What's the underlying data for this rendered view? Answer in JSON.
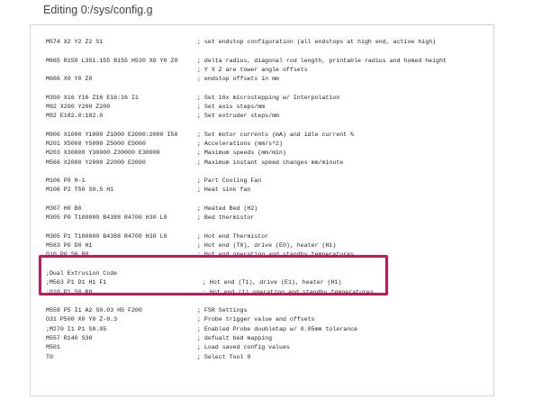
{
  "header": {
    "title": "Editing 0:/sys/config.g"
  },
  "colors": {
    "highlight_border": "#c2185b",
    "editor_border": "#d6d6d6"
  },
  "editor": {
    "lines": [
      {
        "code": "M574 X2 Y2 Z2 S1",
        "comment": "; set endstop configuration (all endstops at high end, active high)"
      },
      {
        "code": "",
        "comment": ""
      },
      {
        "code": "M665 R150 L351.155 B155 H530 X0 Y0 Z0",
        "comment": "; delta radius, diagonal rod length, printable radius and homed height"
      },
      {
        "code": "",
        "comment": "; Y X Z are tower angle offsets"
      },
      {
        "code": "M666 X0 Y0 Z0",
        "comment": "; endstop offsets in mm"
      },
      {
        "code": "",
        "comment": ""
      },
      {
        "code": "M350 X16 Y16 Z16 E16:16 I1",
        "comment": "; Set 16x microstepping w/ Interpolation"
      },
      {
        "code": "M92 X200 Y200 Z200",
        "comment": "; Set axis steps/mm"
      },
      {
        "code": "M92 E182.0:182.0",
        "comment": "; Set extruder steps/mm"
      },
      {
        "code": "",
        "comment": ""
      },
      {
        "code": "M906 X1000 Y1000 Z1000 E2000:2000 I50",
        "comment": "; Set motor currents (mA) and idle current %"
      },
      {
        "code": "M201 X5000 Y5000 Z5000 E5000",
        "comment": "; Accelerations (mm/s^2)"
      },
      {
        "code": "M203 X30000 Y30000 Z30000 E30000",
        "comment": "; Maximum speeds (mm/min)"
      },
      {
        "code": "M566 X2000 Y2000 Z2000 E2000",
        "comment": "; Maximum instant speed changes mm/minute"
      },
      {
        "code": "",
        "comment": ""
      },
      {
        "code": "M106 P0 H-1",
        "comment": "; Part Cooling Fan"
      },
      {
        "code": "M106 P2 T50 S0.5 H1",
        "comment": "; Heat sink fan"
      },
      {
        "code": "",
        "comment": ""
      },
      {
        "code": "M307 H0 B0",
        "comment": "; Heated Bed (H2)"
      },
      {
        "code": "M305 P0 T100000 B4388 R4700 H30 L0",
        "comment": "; Bed thermistor"
      },
      {
        "code": "",
        "comment": ""
      },
      {
        "code": "M305 P1 T100000 B4388 R4700 H30 L0",
        "comment": "; Hot end Thermistor"
      },
      {
        "code": "M563 P0 D0 H1",
        "comment": "; Hot end (T0), drive (E0), heater (H1)"
      },
      {
        "code": "G10 P0 S0 R0",
        "comment": "; Hot end operating and standby temperatures"
      },
      {
        "code": "",
        "comment": ""
      },
      {
        "code": ";Dual Extrusion Code",
        "comment": ""
      },
      {
        "code": ";M563 P1 D1 H1 F1",
        "comment": "; Hot end (T1), drive (E1), heater (H1)"
      },
      {
        "code": ";G10 P1 S0 R0",
        "comment": "; Hot end (1) operating and standby temperatures"
      },
      {
        "code": "",
        "comment": ""
      },
      {
        "code": "M558 P5 I1 A2 S0.03 H5 F200",
        "comment": "; FSR Settings"
      },
      {
        "code": "G31 P500 X0 Y0 Z-0.3",
        "comment": "; Probe trigger value and offsets"
      },
      {
        "code": ";M270 I1 P1 S0.05",
        "comment": "; Enabled Probe doubletap w/ 0.05mm tolerance"
      },
      {
        "code": "M557 R140 S30",
        "comment": "; defualt bed mapping"
      },
      {
        "code": "M501",
        "comment": "; Load saved config values"
      },
      {
        "code": "T0",
        "comment": "; Select Tool 0"
      }
    ]
  }
}
